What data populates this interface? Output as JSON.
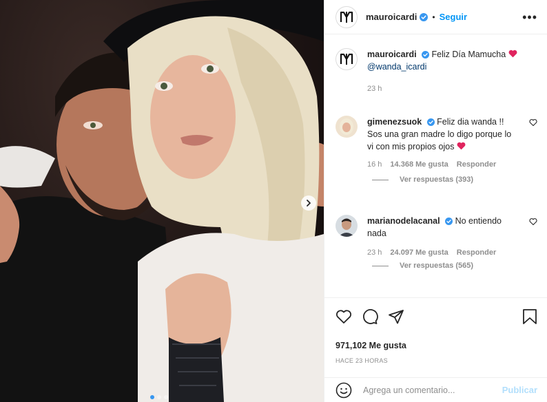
{
  "post": {
    "author": "mauroicardi",
    "follow_label": "Seguir",
    "separator": "•",
    "more_icon": "more-options-icon",
    "caption_text": "Feliz Día Mamucha",
    "caption_mention": "@wanda_icardi",
    "caption_time": "23 h",
    "likes": "971,102 Me gusta",
    "time_ago": "HACE 23 HORAS",
    "carousel_index": 1,
    "carousel_total": 3
  },
  "comments": [
    {
      "user": "gimenezsuok",
      "text": "Feliz dia wanda !! Sos una gran madre lo digo porque lo vi con mis propios ojos",
      "time": "16 h",
      "likes": "14.368 Me gusta",
      "reply_label": "Responder",
      "view_replies": "Ver respuestas (393)"
    },
    {
      "user": "marianodelacanal",
      "text": "No entiendo nada",
      "time": "23 h",
      "likes": "24.097 Me gusta",
      "reply_label": "Responder",
      "view_replies": "Ver respuestas (565)"
    }
  ],
  "add_comment": {
    "placeholder": "Agrega un comentario...",
    "publish_label": "Publicar"
  },
  "colors": {
    "accent": "#0095f6",
    "heart": "#ed4956",
    "verified": "#3897f0",
    "muted": "#8e8e8e"
  }
}
